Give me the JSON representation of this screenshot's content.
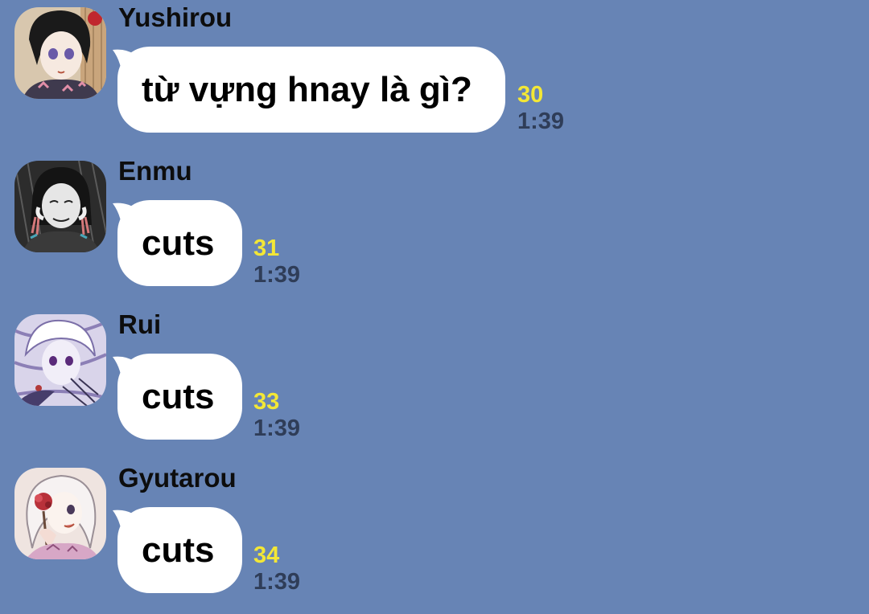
{
  "messages": [
    {
      "sender": "Yushirou",
      "text": "từ vựng hnay là gì?",
      "read_count": "30",
      "time": "1:39",
      "avatar_icon": "anime-portrait-woman-kimono"
    },
    {
      "sender": "Enmu",
      "text": "cuts",
      "read_count": "31",
      "time": "1:39",
      "avatar_icon": "anime-portrait-dark-figure"
    },
    {
      "sender": "Rui",
      "text": "cuts",
      "read_count": "33",
      "time": "1:39",
      "avatar_icon": "anime-portrait-white-haired-boy"
    },
    {
      "sender": "Gyutarou",
      "text": "cuts",
      "read_count": "34",
      "time": "1:39",
      "avatar_icon": "anime-portrait-white-haired-girl"
    }
  ],
  "colors": {
    "background": "#6784b5",
    "bubble": "#ffffff",
    "read_count": "#f3e736",
    "time": "#2f3d58"
  }
}
